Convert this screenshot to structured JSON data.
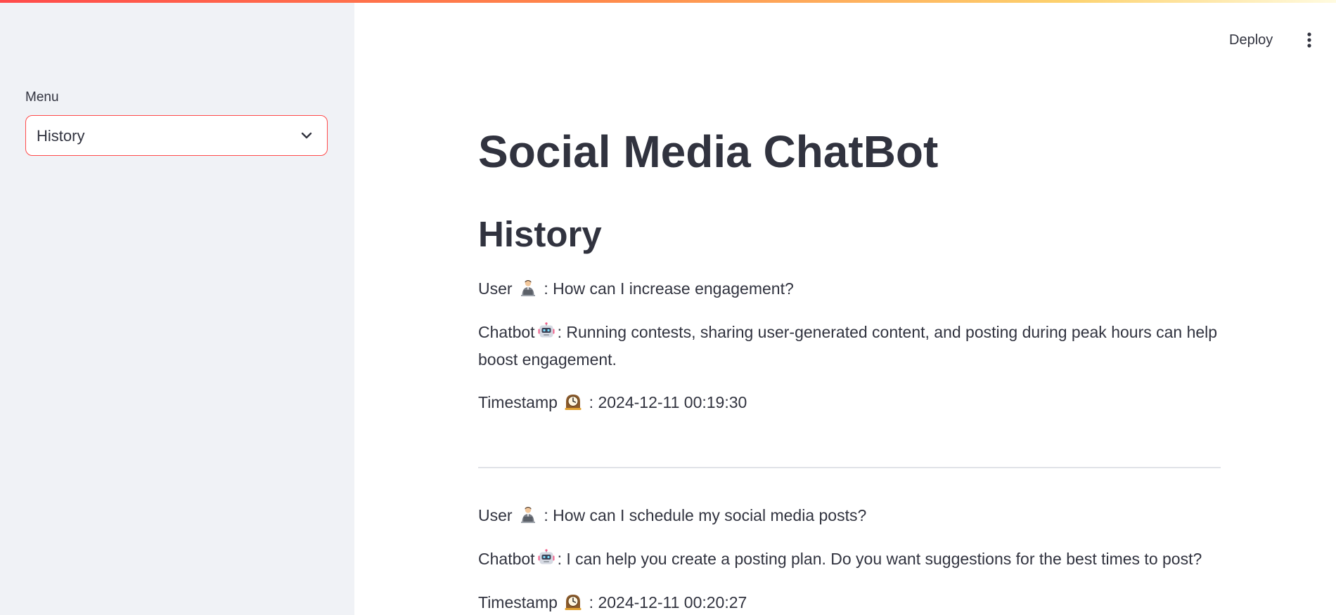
{
  "sidebar": {
    "menu_label": "Menu",
    "menu_selected": "History"
  },
  "header": {
    "deploy_label": "Deploy",
    "more_icon": "vertical-ellipsis-icon"
  },
  "main": {
    "title": "Social Media ChatBot",
    "section_title": "History",
    "entries": [
      {
        "user_label": "User",
        "user_icon": "office-worker-emoji",
        "user_text": ": How can I increase engagement?",
        "bot_label": "Chatbot",
        "bot_icon": "robot-emoji",
        "bot_text": ": Running contests, sharing user-generated content, and posting during peak hours can help boost engagement.",
        "ts_label": "Timestamp",
        "ts_icon": "mantelpiece-clock-emoji",
        "ts_text": ": 2024-12-11 00:19:30"
      },
      {
        "user_label": "User",
        "user_icon": "office-worker-emoji",
        "user_text": ": How can I schedule my social media posts?",
        "bot_label": "Chatbot",
        "bot_icon": "robot-emoji",
        "bot_text": ": I can help you create a posting plan. Do you want suggestions for the best times to post?",
        "ts_label": "Timestamp",
        "ts_icon": "mantelpiece-clock-emoji",
        "ts_text": ": 2024-12-11 00:20:27"
      }
    ]
  },
  "colors": {
    "accent": "#ff4b4b",
    "sidebar_bg": "#f0f2f6",
    "text": "#31333f",
    "divider": "#e1e3e8"
  }
}
